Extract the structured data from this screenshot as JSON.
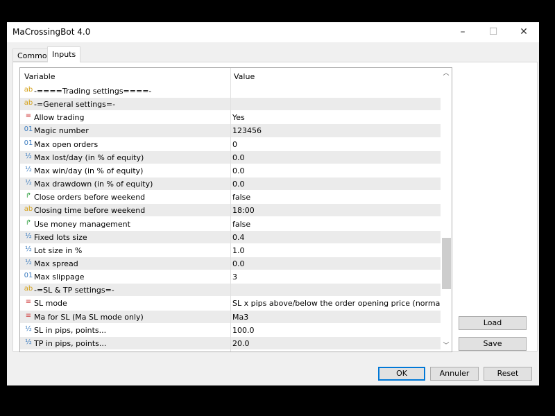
{
  "window": {
    "title": "MaCrossingBot 4.0",
    "minimize": "–",
    "maximize": "☐",
    "close": "✕"
  },
  "tabs": [
    {
      "label": "Common",
      "active": false
    },
    {
      "label": "Inputs",
      "active": true
    }
  ],
  "table": {
    "headers": {
      "variable": "Variable",
      "value": "Value"
    },
    "rows": [
      {
        "icon": "string-icon",
        "glyph": "ab",
        "color": "#d4a017",
        "variable": "-====Trading settings====-",
        "value": ""
      },
      {
        "icon": "string-icon",
        "glyph": "ab",
        "color": "#d4a017",
        "variable": "-=General settings=-",
        "value": ""
      },
      {
        "icon": "enum-icon",
        "glyph": "≡",
        "color": "#d04040",
        "variable": "Allow trading",
        "value": "Yes"
      },
      {
        "icon": "integer-icon",
        "glyph": "01",
        "color": "#3a7bbf",
        "variable": "Magic number",
        "value": "123456"
      },
      {
        "icon": "integer-icon",
        "glyph": "01",
        "color": "#3a7bbf",
        "variable": "Max open orders",
        "value": "0"
      },
      {
        "icon": "double-icon",
        "glyph": "½",
        "color": "#3a7bbf",
        "variable": "Max lost/day (in % of equity)",
        "value": "0.0"
      },
      {
        "icon": "double-icon",
        "glyph": "½",
        "color": "#3a7bbf",
        "variable": "Max win/day (in % of equity)",
        "value": "0.0"
      },
      {
        "icon": "double-icon",
        "glyph": "½",
        "color": "#3a7bbf",
        "variable": "Max drawdown (in % of equity)",
        "value": "0.0"
      },
      {
        "icon": "bool-icon",
        "glyph": "↱",
        "color": "#2e9e3e",
        "variable": "Close orders before weekend",
        "value": "false"
      },
      {
        "icon": "string-icon",
        "glyph": "ab",
        "color": "#d4a017",
        "variable": "Closing time before weekend",
        "value": "18:00"
      },
      {
        "icon": "bool-icon",
        "glyph": "↱",
        "color": "#2e9e3e",
        "variable": "Use money management",
        "value": "false"
      },
      {
        "icon": "double-icon",
        "glyph": "½",
        "color": "#3a7bbf",
        "variable": "Fixed lots size",
        "value": "0.4"
      },
      {
        "icon": "double-icon",
        "glyph": "½",
        "color": "#3a7bbf",
        "variable": "Lot size in %",
        "value": "1.0"
      },
      {
        "icon": "double-icon",
        "glyph": "½",
        "color": "#3a7bbf",
        "variable": "Max spread",
        "value": "0.0"
      },
      {
        "icon": "integer-icon",
        "glyph": "01",
        "color": "#3a7bbf",
        "variable": "Max slippage",
        "value": "3"
      },
      {
        "icon": "string-icon",
        "glyph": "ab",
        "color": "#d4a017",
        "variable": "-=SL & TP settings=-",
        "value": ""
      },
      {
        "icon": "enum-icon",
        "glyph": "≡",
        "color": "#d04040",
        "variable": "SL mode",
        "value": "SL x pips above/below the order opening price (normal SL mode)"
      },
      {
        "icon": "enum-icon",
        "glyph": "≡",
        "color": "#d04040",
        "variable": "Ma for SL (Ma SL mode only)",
        "value": "Ma3"
      },
      {
        "icon": "double-icon",
        "glyph": "½",
        "color": "#3a7bbf",
        "variable": "SL in pips, points...",
        "value": "100.0"
      },
      {
        "icon": "double-icon",
        "glyph": "½",
        "color": "#3a7bbf",
        "variable": "TP in pips, points...",
        "value": "20.0"
      }
    ],
    "scroll_position_percent": 62
  },
  "side_buttons": {
    "load": "Load",
    "save": "Save"
  },
  "footer": {
    "ok": "OK",
    "cancel": "Annuler",
    "reset": "Reset"
  },
  "colors": {
    "default_button_border": "#0078d7",
    "alt_row": "#ebebeb"
  }
}
